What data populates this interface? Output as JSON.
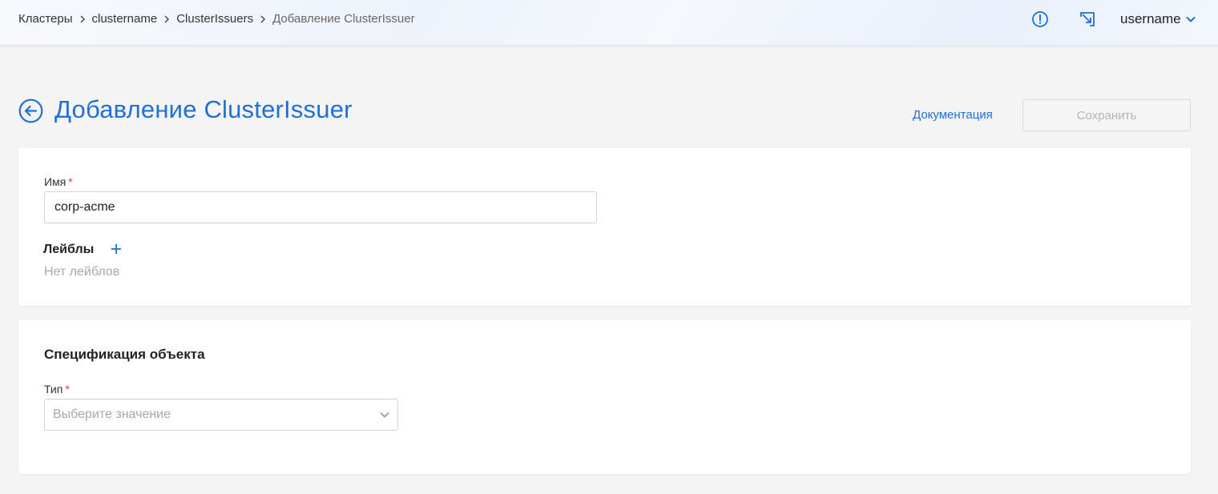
{
  "breadcrumb": {
    "items": [
      "Кластеры",
      "clustername",
      "ClusterIssuers"
    ],
    "current": "Добавление ClusterIssuer"
  },
  "header": {
    "alert_icon": "alert-circle-icon",
    "expand_icon": "expand-arrow-icon",
    "username": "username"
  },
  "page": {
    "title": "Добавление ClusterIssuer",
    "back_icon": "arrow-left-circle-icon",
    "doc_link": "Документация",
    "save_label": "Сохранить"
  },
  "metadata_card": {
    "name_label": "Имя",
    "required_mark": "*",
    "name_value": "corp-acme",
    "labels_title": "Лейблы",
    "labels_empty": "Нет лейблов",
    "add_icon": "plus-icon"
  },
  "spec_card": {
    "title": "Спецификация объекта",
    "type_label": "Тип",
    "required_mark": "*",
    "type_placeholder": "Выберите значение",
    "dropdown_icon": "chevron-down-icon"
  },
  "colors": {
    "accent": "#1f6fd6",
    "required": "#e53935",
    "background": "#f4f4f4"
  }
}
